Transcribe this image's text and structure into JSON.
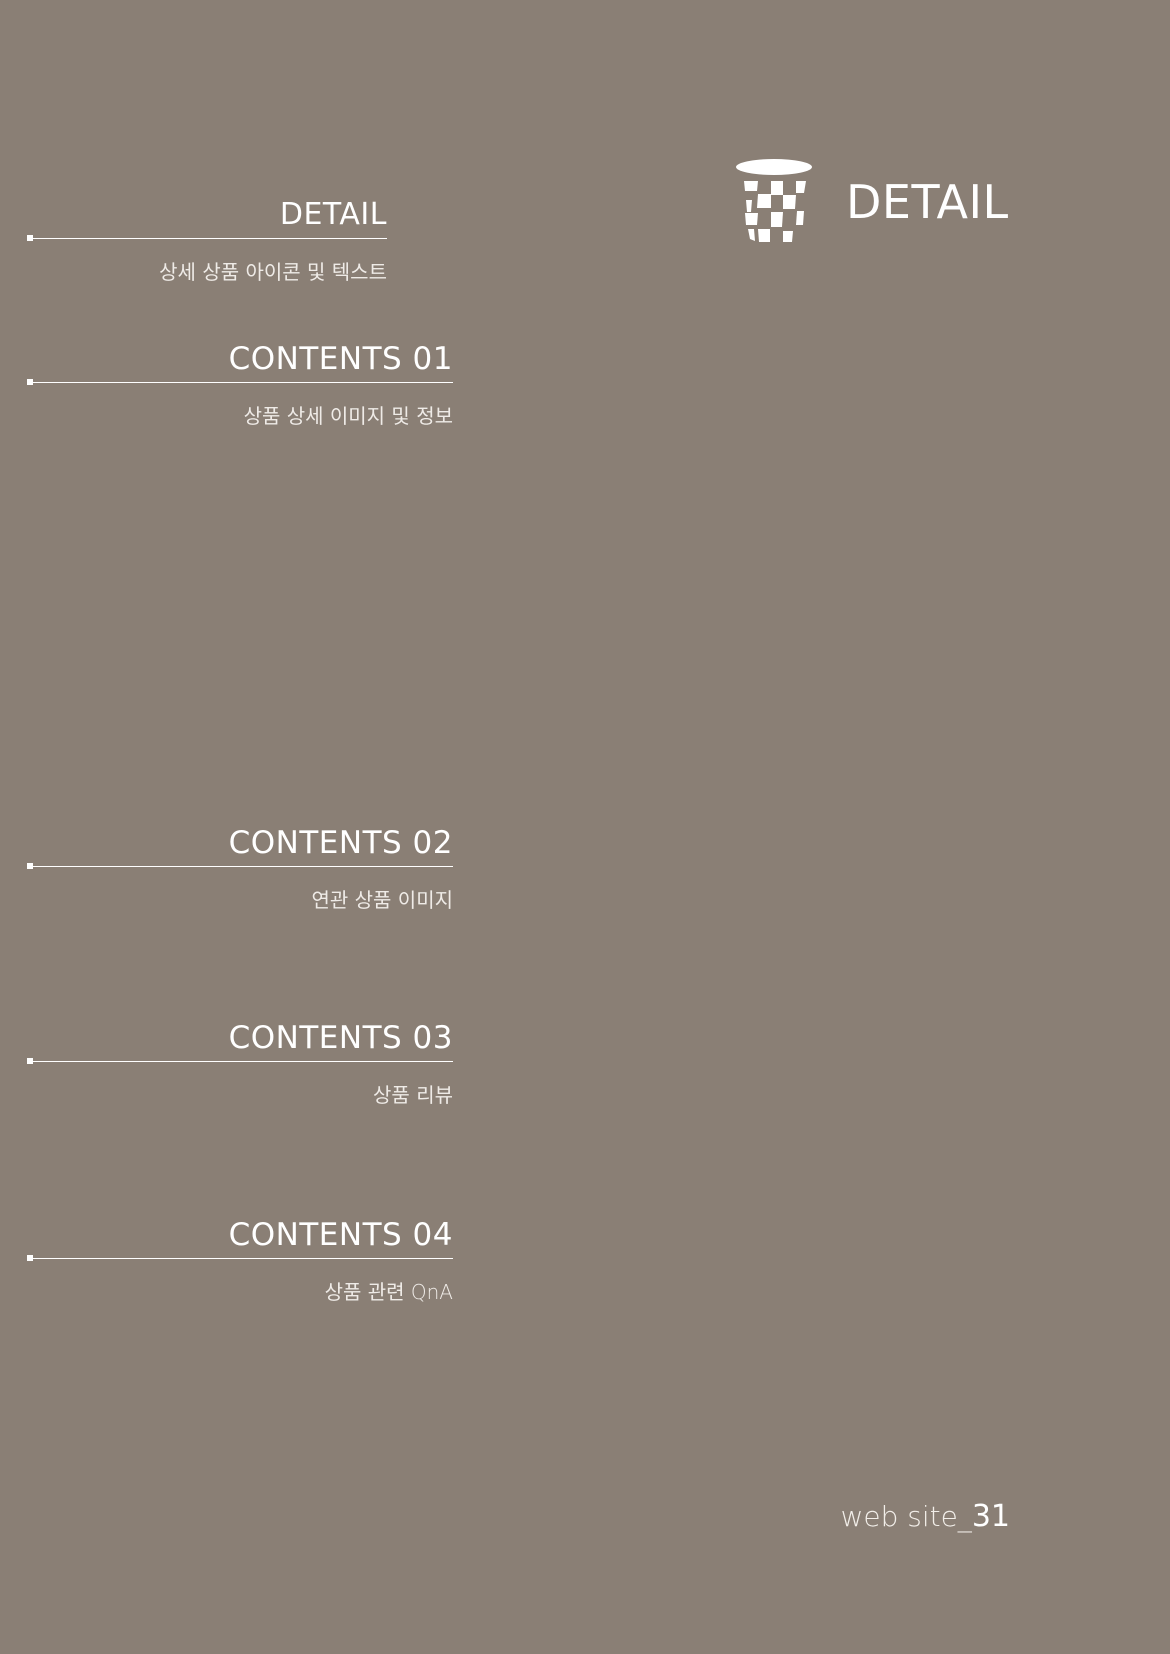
{
  "colors": {
    "background": "#8a7f75",
    "text": "#ffffff"
  },
  "hero": {
    "icon": "cup-icon",
    "title": "DETAIL"
  },
  "sections": [
    {
      "title": "DETAIL",
      "subtitle": "상세 상품 아이콘 및 텍스트"
    },
    {
      "title": "CONTENTS 01",
      "subtitle": "상품 상세 이미지 및 정보"
    },
    {
      "title": "CONTENTS 02",
      "subtitle": "연관 상품 이미지"
    },
    {
      "title": "CONTENTS 03",
      "subtitle": "상품 리뷰"
    },
    {
      "title": "CONTENTS 04",
      "subtitle": "상품 관련 QnA"
    }
  ],
  "footer": {
    "label": "web site_",
    "page_number": "31"
  }
}
